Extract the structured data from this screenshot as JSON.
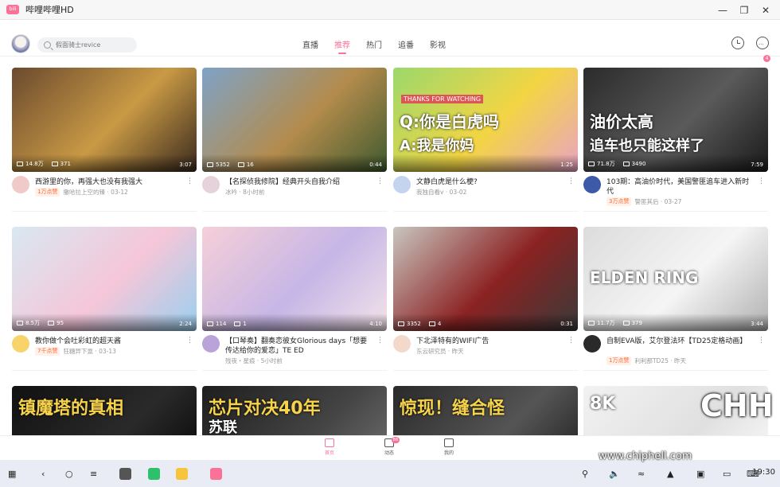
{
  "window": {
    "title": "哔哩哔哩HD",
    "app_icon_text": "bili"
  },
  "header": {
    "search_placeholder": "假面骑士revice",
    "tabs": [
      {
        "label": "直播",
        "active": false
      },
      {
        "label": "推荐",
        "active": true
      },
      {
        "label": "热门",
        "active": false
      },
      {
        "label": "追番",
        "active": false
      },
      {
        "label": "影视",
        "active": false
      }
    ],
    "message_badge": "4"
  },
  "cards": [
    {
      "views": "14.8万",
      "comments": "371",
      "duration": "3:07",
      "title": "西游里的你，再强大也没有我强大",
      "badge": "1万点赞",
      "author": "撒哈拉上空的臻",
      "date": "03-12",
      "thumb_colors": [
        "#6b4a2e",
        "#c99a45",
        "#3a2a1e"
      ],
      "avatar_color": "#f0c9c9"
    },
    {
      "views": "5352",
      "comments": "16",
      "duration": "0:44",
      "title": "【名探侦我修院】经典开头自我介绍",
      "badge": "",
      "author": "冰吟",
      "date": "8小时前",
      "thumb_colors": [
        "#7fa3c8",
        "#b38b4c",
        "#3e5a2e"
      ],
      "avatar_color": "#e6d2da"
    },
    {
      "views": "",
      "comments": "",
      "duration": "1:25",
      "title": "文静白虎是什么梗?",
      "badge": "",
      "author": "我独自看v",
      "date": "03-02",
      "thumb_colors": [
        "#9bd86b",
        "#f3d544",
        "#e8a3c3"
      ],
      "avatar_color": "#c4d4ef",
      "thumb_text_1": "Q:你是白虎吗",
      "thumb_text_2": "A:我是你妈",
      "thumb_banner": "THANKS FOR WATCHING"
    },
    {
      "views": "71.8万",
      "comments": "3490",
      "duration": "7:59",
      "title": "103期：高油价时代，美国警匪追车进入新时代",
      "badge": "3万点赞",
      "author": "警匪其后",
      "date": "03-27",
      "thumb_colors": [
        "#2b2b2b",
        "#5a5a5a",
        "#1a1a1a"
      ],
      "avatar_color": "#3d5aa8",
      "thumb_text_1": "油价太高",
      "thumb_text_2": "追车也只能这样了"
    },
    {
      "views": "8.5万",
      "comments": "95",
      "duration": "2:24",
      "title": "教你做个会吐彩虹的超天酱",
      "badge": "7千点赞",
      "author": "狂糖异下禀",
      "date": "03-13",
      "thumb_colors": [
        "#d9e8f2",
        "#f5c6d8",
        "#9ad0f0"
      ],
      "avatar_color": "#f7d36a"
    },
    {
      "views": "114",
      "comments": "1",
      "duration": "4:10",
      "title": "【口琴奏】翻奏恋彼女Glorious days「想要传达给你的爱恋」TE ED",
      "badge": "",
      "author": "残夜・星痕",
      "date": "5小时前",
      "thumb_colors": [
        "#f6cfd9",
        "#c6b6e6",
        "#f3e3e9"
      ],
      "avatar_color": "#b9a3d8"
    },
    {
      "views": "3352",
      "comments": "4",
      "duration": "0:31",
      "title": "下北泽特有的WIFI广告",
      "badge": "",
      "author": "东云研究员",
      "date": "昨天",
      "thumb_colors": [
        "#c9c6c0",
        "#8b2222",
        "#3a3a3a"
      ],
      "avatar_color": "#f3d9c9"
    },
    {
      "views": "11.7万",
      "comments": "379",
      "duration": "3:44",
      "title": "自制EVA版，艾尔登法环【TD25定格动画】",
      "badge": "1万点赞",
      "author": "利利那TD25",
      "date": "昨天",
      "thumb_colors": [
        "#dcdcdc",
        "#f5f5f5",
        "#b0b0b0"
      ],
      "avatar_color": "#2a2a2a",
      "thumb_text_1": "ELDEN RING"
    },
    {
      "thumb_colors": [
        "#111111",
        "#2a2a2a",
        "#000000"
      ],
      "thumb_text_1": "镇魔塔的真相"
    },
    {
      "thumb_colors": [
        "#1e1e1e",
        "#444444",
        "#777777"
      ],
      "thumb_text_1": "芯片对决40年",
      "thumb_text_2": "苏联"
    },
    {
      "thumb_colors": [
        "#2a2a2a",
        "#555555",
        "#151515"
      ],
      "thumb_text_1": "惊现！缝合怪"
    },
    {
      "thumb_colors": [
        "#f2f2f2",
        "#e0e0e0",
        "#ffffff"
      ],
      "thumb_text_1": "8K"
    }
  ],
  "tabbar": [
    {
      "label": "首页",
      "active": true
    },
    {
      "label": "动态",
      "active": false,
      "badge": "86"
    },
    {
      "label": "我的",
      "active": false
    }
  ],
  "taskbar": {
    "clock": "19:30"
  },
  "watermark": {
    "site": "www.chiphell.com",
    "logo": "CHH"
  },
  "colors": {
    "accent": "#fb7299",
    "text": "#222222",
    "muted": "#999999"
  }
}
